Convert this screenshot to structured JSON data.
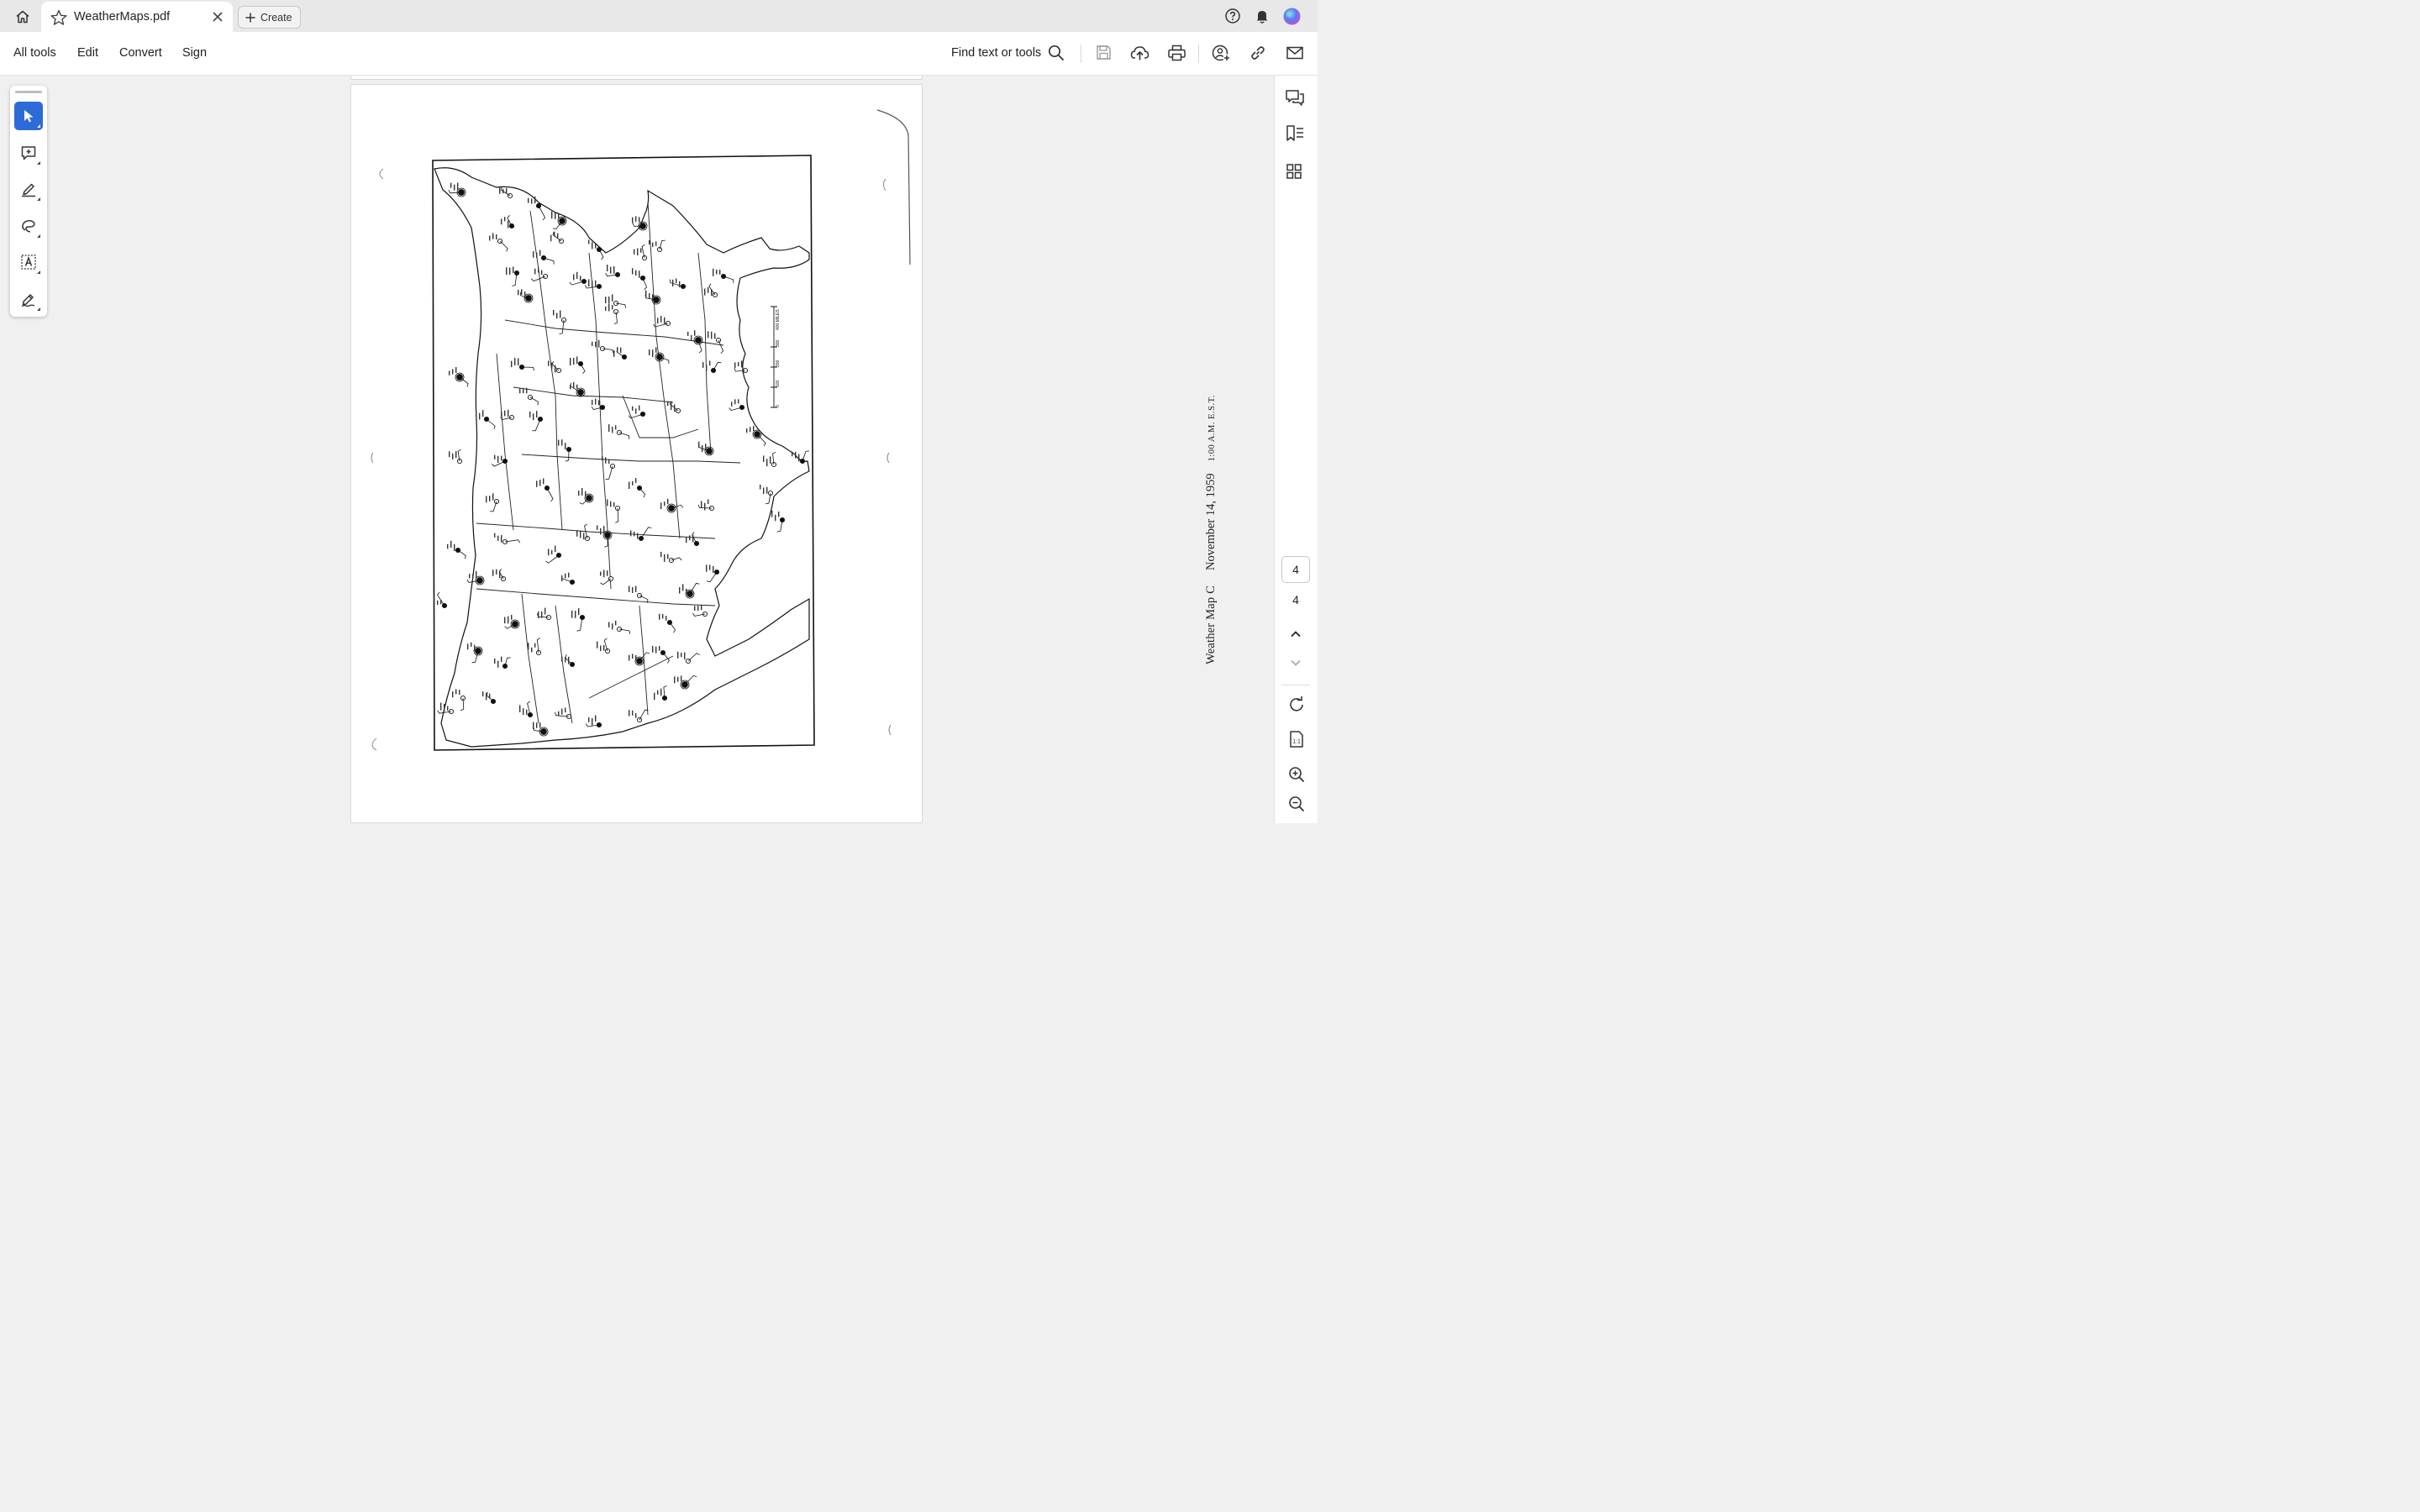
{
  "tab": {
    "title": "WeatherMaps.pdf",
    "create_label": "Create"
  },
  "menu": {
    "all_tools": "All tools",
    "edit": "Edit",
    "convert": "Convert",
    "sign": "Sign",
    "find": "Find text or tools"
  },
  "pager": {
    "current": "4",
    "total": "4"
  },
  "document": {
    "caption_title": "Weather Map C",
    "caption_date": "November 14, 1959",
    "caption_time": "1:00 A.M. E.S.T.",
    "scale_labels": [
      "0",
      "100",
      "200",
      "300",
      "400 MILES"
    ]
  },
  "colors": {
    "accent": "#2c6bd8",
    "tabbar": "#e8e8e8",
    "canvas": "#f0f0f0"
  },
  "icons": {
    "top": [
      "home-icon",
      "star-icon",
      "close-icon",
      "plus-icon",
      "help-icon",
      "bell-icon",
      "avatar"
    ],
    "toolbar": [
      "search-icon",
      "save-icon",
      "upload-icon",
      "print-icon",
      "share-icon",
      "link-icon",
      "mail-icon"
    ],
    "left": [
      "cursor-icon",
      "add-comment-icon",
      "highlight-icon",
      "freehand-icon",
      "text-select-icon",
      "signature-icon"
    ],
    "right": [
      "comments-icon",
      "bookmarks-icon",
      "thumbnails-icon",
      "chevron-up-icon",
      "chevron-down-icon",
      "rotate-icon",
      "fit-page-icon",
      "zoom-in-icon",
      "zoom-out-icon"
    ]
  }
}
